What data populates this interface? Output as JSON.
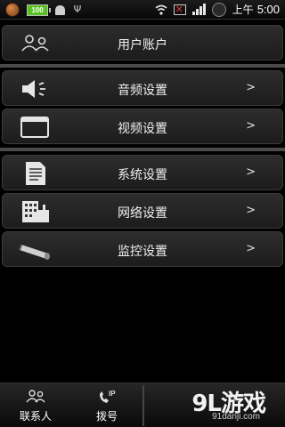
{
  "status_bar": {
    "battery_level": "100",
    "time_prefix": "上午",
    "time": "5:00",
    "icons": [
      "basketball-app-icon",
      "battery-icon",
      "android-debug-icon",
      "usb-icon",
      "wifi-icon",
      "no-sim-icon",
      "signal-icon",
      "clock-icon"
    ]
  },
  "menu": {
    "user_account": {
      "label": "用户账户",
      "icon": "users-icon"
    },
    "audio": {
      "label": "音频设置",
      "arrow": ">",
      "icon": "speaker-icon"
    },
    "video": {
      "label": "视频设置",
      "arrow": ">",
      "icon": "window-icon"
    },
    "system": {
      "label": "系统设置",
      "arrow": ">",
      "icon": "document-icon"
    },
    "network": {
      "label": "网络设置",
      "arrow": ">",
      "icon": "network-icon"
    },
    "monitor": {
      "label": "监控设置",
      "arrow": ">",
      "icon": "telescope-icon"
    }
  },
  "bottom_tabs": {
    "contacts": {
      "label": "联系人",
      "icon": "contacts-icon"
    },
    "dial": {
      "label": "拨号",
      "icon": "ip-dial-icon"
    }
  },
  "watermark": {
    "logo": "9L游戏",
    "url": "91danji.com"
  }
}
